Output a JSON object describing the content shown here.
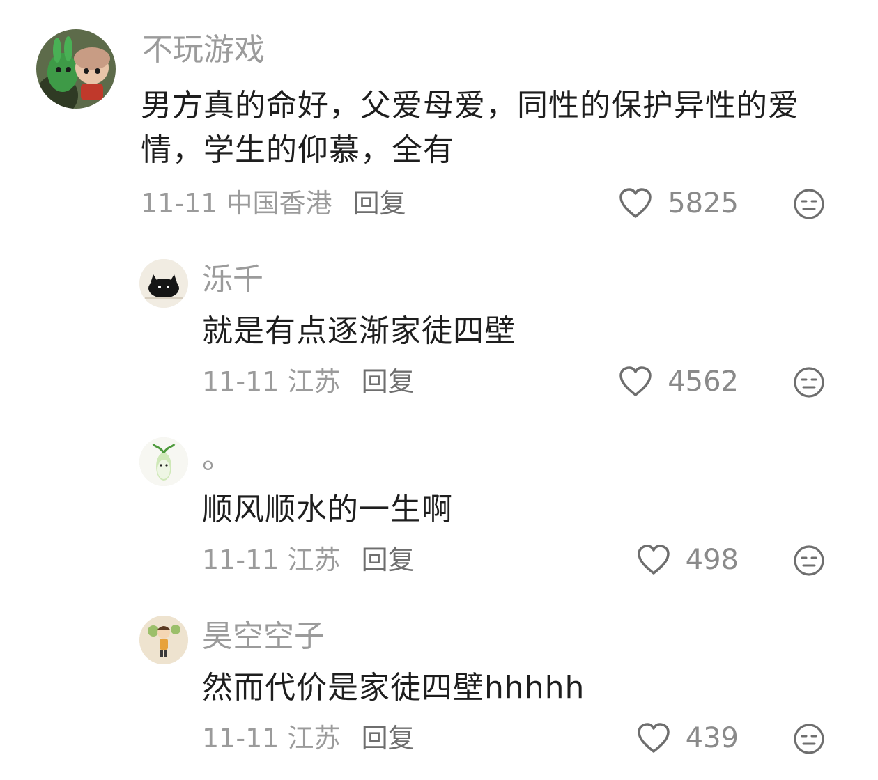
{
  "comments": [
    {
      "username": "不玩游戏",
      "content": "男方真的命好，父爱母爱，同性的保护异性的爱情，学生的仰慕，全有",
      "date": "11-11",
      "location": "中国香港",
      "reply_label": "回复",
      "likes": "5825",
      "avatar_icon": "toy-figures-avatar"
    },
    {
      "username": "泺千",
      "content": "就是有点逐渐家徒四壁",
      "date": "11-11",
      "location": "江苏",
      "reply_label": "回复",
      "likes": "4562",
      "avatar_icon": "black-cat-avatar"
    },
    {
      "username": "。",
      "content": "顺风顺水的一生啊",
      "date": "11-11",
      "location": "江苏",
      "reply_label": "回复",
      "likes": "498",
      "avatar_icon": "radish-avatar"
    },
    {
      "username": "昊空空子",
      "content": "然而代价是家徒四壁hhhhh",
      "date": "11-11",
      "location": "江苏",
      "reply_label": "回复",
      "likes": "439",
      "avatar_icon": "cartoon-person-avatar"
    }
  ],
  "colors": {
    "username": "#9b9b9b",
    "content": "#1e1e1e",
    "meta": "#9b9b9b",
    "icon": "#6e6e6e"
  }
}
